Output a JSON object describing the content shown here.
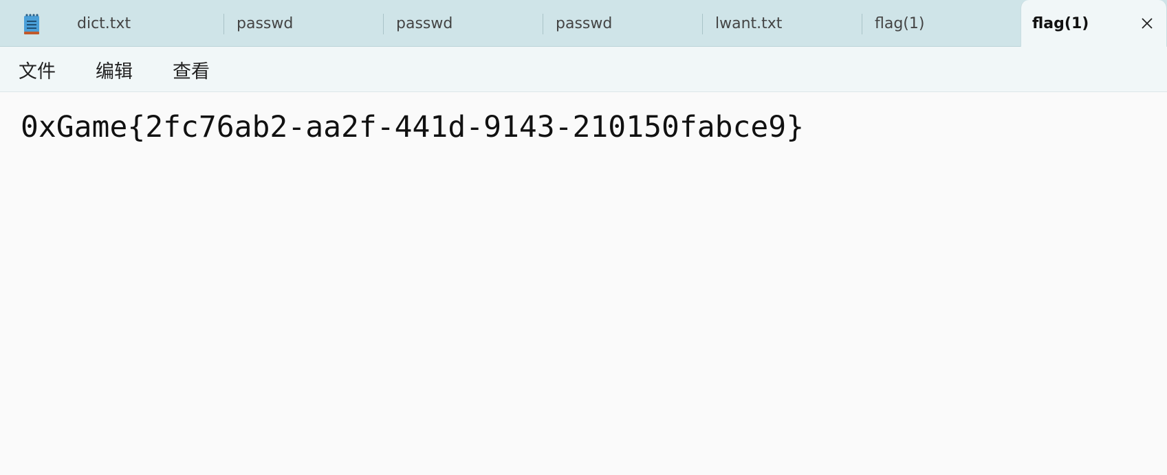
{
  "tabs": [
    {
      "label": "dict.txt"
    },
    {
      "label": "passwd"
    },
    {
      "label": "passwd"
    },
    {
      "label": "passwd"
    },
    {
      "label": "lwant.txt"
    },
    {
      "label": "flag(1)"
    },
    {
      "label": "flag(1)",
      "active": true
    }
  ],
  "menu": {
    "file": "文件",
    "edit": "编辑",
    "view": "查看"
  },
  "editor": {
    "content": "0xGame{2fc76ab2-aa2f-441d-9143-210150fabce9}"
  },
  "icons": {
    "app": "notepad-icon",
    "close": "close-icon"
  },
  "colors": {
    "tabbar_bg": "#cfe4e8",
    "active_tab_bg": "#f1f7f8",
    "editor_bg": "#fafafa"
  }
}
